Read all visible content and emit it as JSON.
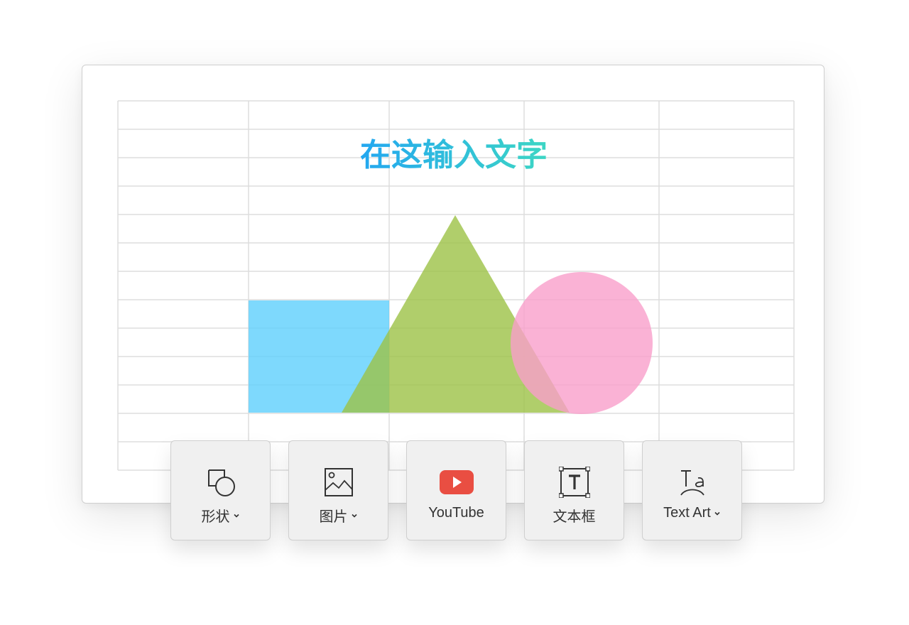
{
  "sheet": {
    "title_text": "在这输入文字",
    "title_gradient": [
      "#23a7f0",
      "#3dd6c4"
    ],
    "grid_line_color": "#dddddd",
    "shapes": {
      "rectangle_color": "#5ecffd",
      "triangle_color": "#9cc246",
      "circle_color": "#f99fcb"
    }
  },
  "toolbar": {
    "items": [
      {
        "label": "形状",
        "icon": "shape-icon",
        "has_dropdown": true
      },
      {
        "label": "图片",
        "icon": "image-icon",
        "has_dropdown": true
      },
      {
        "label": "YouTube",
        "icon": "youtube-icon",
        "has_dropdown": false,
        "accent": "#e94e42"
      },
      {
        "label": "文本框",
        "icon": "textbox-icon",
        "has_dropdown": false
      },
      {
        "label": "Text Art",
        "icon": "text-art-icon",
        "has_dropdown": true
      }
    ]
  }
}
